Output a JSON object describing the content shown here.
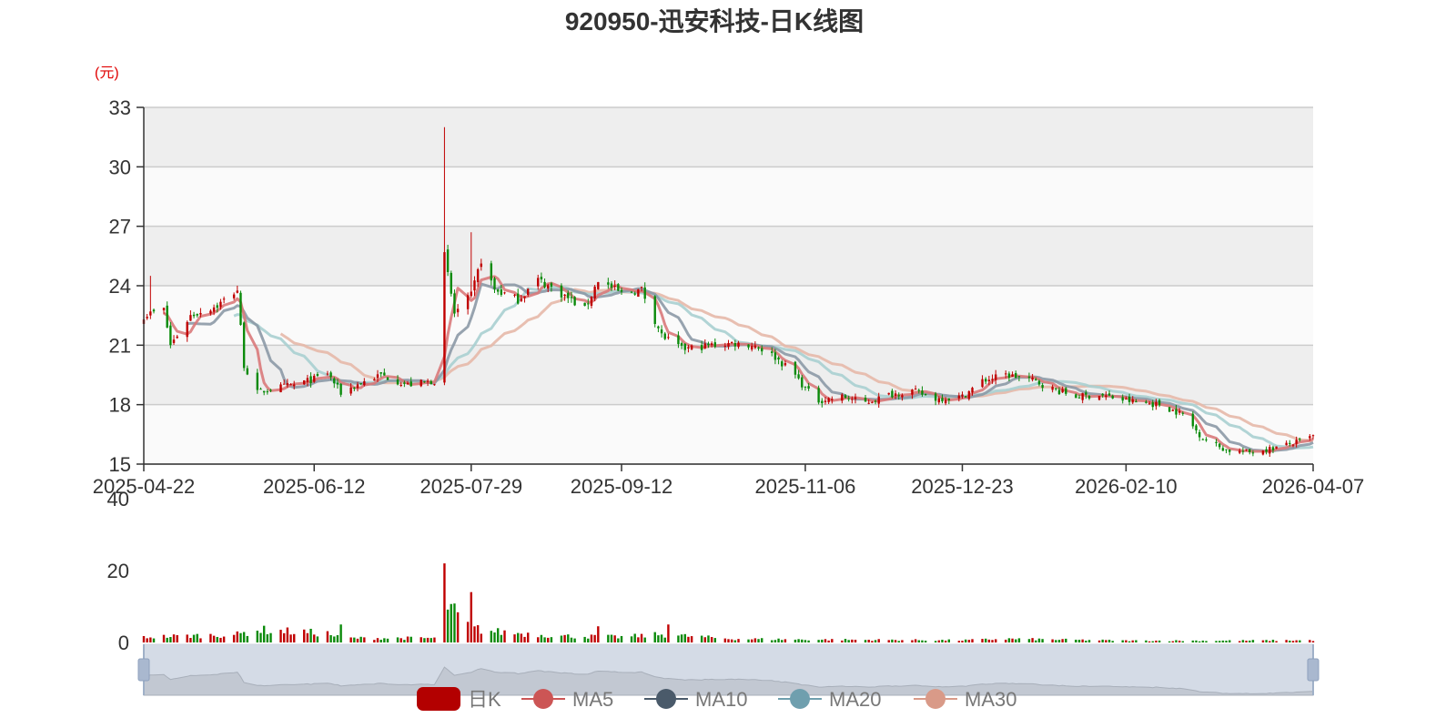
{
  "title": "920950-迅安科技-日K线图",
  "unit_label": "(元)",
  "colors": {
    "up": "#c00000",
    "down": "#0a8a0a",
    "ma5": "#d9797a",
    "ma10": "#8c99a6",
    "ma20": "#a8cfd0",
    "ma30": "#e5b8a8"
  },
  "legend": [
    {
      "label": "日K",
      "icon": "kline-legend-icon",
      "color": "#b30000"
    },
    {
      "label": "MA5",
      "icon": "ma5-legend-icon",
      "color": "#cc5555"
    },
    {
      "label": "MA10",
      "icon": "ma10-legend-icon",
      "color": "#4a5a6a"
    },
    {
      "label": "MA20",
      "icon": "ma20-legend-icon",
      "color": "#6f9fae"
    },
    {
      "label": "MA30",
      "icon": "ma30-legend-icon",
      "color": "#d99a88"
    }
  ],
  "chart_data": [
    {
      "type": "candlestick",
      "title": "920950-迅安科技-日K线图",
      "ylabel": "(元)",
      "ylim": [
        15,
        33
      ],
      "yticks": [
        15,
        18,
        21,
        24,
        27,
        30,
        33
      ],
      "xlabels": [
        "2025-04-22",
        "2025-06-12",
        "2025-07-29",
        "2025-09-12",
        "2025-11-06",
        "2025-12-23",
        "2026-02-10",
        "2026-04-07"
      ],
      "x_range": [
        "2025-04-22",
        "2026-04-07"
      ],
      "grid": true,
      "series_names": [
        "日K",
        "MA5",
        "MA10",
        "MA20",
        "MA30"
      ],
      "close_keypoints": [
        [
          "2025-04-22",
          22.5
        ],
        [
          "2025-04-28",
          22.8
        ],
        [
          "2025-04-30",
          21.0
        ],
        [
          "2025-05-06",
          22.5
        ],
        [
          "2025-05-14",
          23.0
        ],
        [
          "2025-05-20",
          23.8
        ],
        [
          "2025-05-22",
          20.0
        ],
        [
          "2025-05-26",
          18.6
        ],
        [
          "2025-05-30",
          18.8
        ],
        [
          "2025-06-06",
          19.0
        ],
        [
          "2025-06-12",
          19.3
        ],
        [
          "2025-06-16",
          19.6
        ],
        [
          "2025-06-20",
          18.6
        ],
        [
          "2025-06-26",
          19.1
        ],
        [
          "2025-07-02",
          19.5
        ],
        [
          "2025-07-10",
          19.0
        ],
        [
          "2025-07-18",
          19.2
        ],
        [
          "2025-07-21",
          25.5
        ],
        [
          "2025-07-24",
          22.6
        ],
        [
          "2025-07-29",
          23.5
        ],
        [
          "2025-08-01",
          25.3
        ],
        [
          "2025-08-05",
          23.8
        ],
        [
          "2025-08-12",
          23.3
        ],
        [
          "2025-08-18",
          24.3
        ],
        [
          "2025-08-25",
          23.6
        ],
        [
          "2025-09-01",
          22.8
        ],
        [
          "2025-09-05",
          24.3
        ],
        [
          "2025-09-12",
          23.6
        ],
        [
          "2025-09-18",
          23.8
        ],
        [
          "2025-09-24",
          21.5
        ],
        [
          "2025-09-30",
          20.8
        ],
        [
          "2025-10-09",
          21.0
        ],
        [
          "2025-10-15",
          21.1
        ],
        [
          "2025-10-22",
          21.0
        ],
        [
          "2025-10-28",
          20.4
        ],
        [
          "2025-11-03",
          19.5
        ],
        [
          "2025-11-06",
          18.8
        ],
        [
          "2025-11-10",
          18.2
        ],
        [
          "2025-11-17",
          18.4
        ],
        [
          "2025-11-24",
          18.1
        ],
        [
          "2025-12-01",
          18.5
        ],
        [
          "2025-12-08",
          18.7
        ],
        [
          "2025-12-15",
          18.3
        ],
        [
          "2025-12-23",
          18.4
        ],
        [
          "2025-12-29",
          19.2
        ],
        [
          "2026-01-05",
          19.5
        ],
        [
          "2026-01-12",
          19.3
        ],
        [
          "2026-01-19",
          18.8
        ],
        [
          "2026-01-26",
          18.4
        ],
        [
          "2026-02-02",
          18.5
        ],
        [
          "2026-02-10",
          18.2
        ],
        [
          "2026-02-20",
          18.0
        ],
        [
          "2026-02-27",
          17.5
        ],
        [
          "2026-03-05",
          16.3
        ],
        [
          "2026-03-12",
          15.7
        ],
        [
          "2026-03-19",
          15.6
        ],
        [
          "2026-03-26",
          15.8
        ],
        [
          "2026-04-02",
          16.1
        ],
        [
          "2026-04-07",
          16.4
        ]
      ],
      "volume": {
        "ylim": [
          0,
          40
        ],
        "yticks": [
          0,
          20,
          40
        ],
        "keypoints": [
          [
            "2025-04-22",
            1.5
          ],
          [
            "2025-05-20",
            2.2
          ],
          [
            "2025-05-26",
            3.5
          ],
          [
            "2025-06-16",
            2.5
          ],
          [
            "2025-06-20",
            1.2
          ],
          [
            "2025-07-18",
            1.2
          ],
          [
            "2025-07-21",
            12.0
          ],
          [
            "2025-07-24",
            8.0
          ],
          [
            "2025-07-29",
            4.0
          ],
          [
            "2025-08-05",
            3.0
          ],
          [
            "2025-08-25",
            1.8
          ],
          [
            "2025-09-12",
            1.5
          ],
          [
            "2025-09-24",
            2.2
          ],
          [
            "2025-10-15",
            1.0
          ],
          [
            "2025-11-06",
            0.8
          ],
          [
            "2025-12-23",
            0.6
          ],
          [
            "2026-01-05",
            1.0
          ],
          [
            "2026-02-10",
            0.5
          ],
          [
            "2026-03-12",
            0.5
          ],
          [
            "2026-04-07",
            0.6
          ]
        ],
        "spikes": [
          [
            "2025-07-21",
            22.0
          ],
          [
            "2025-07-29",
            14.0
          ],
          [
            "2025-06-20",
            5.0
          ],
          [
            "2025-09-05",
            4.5
          ],
          [
            "2025-09-26",
            5.0
          ]
        ]
      }
    }
  ]
}
